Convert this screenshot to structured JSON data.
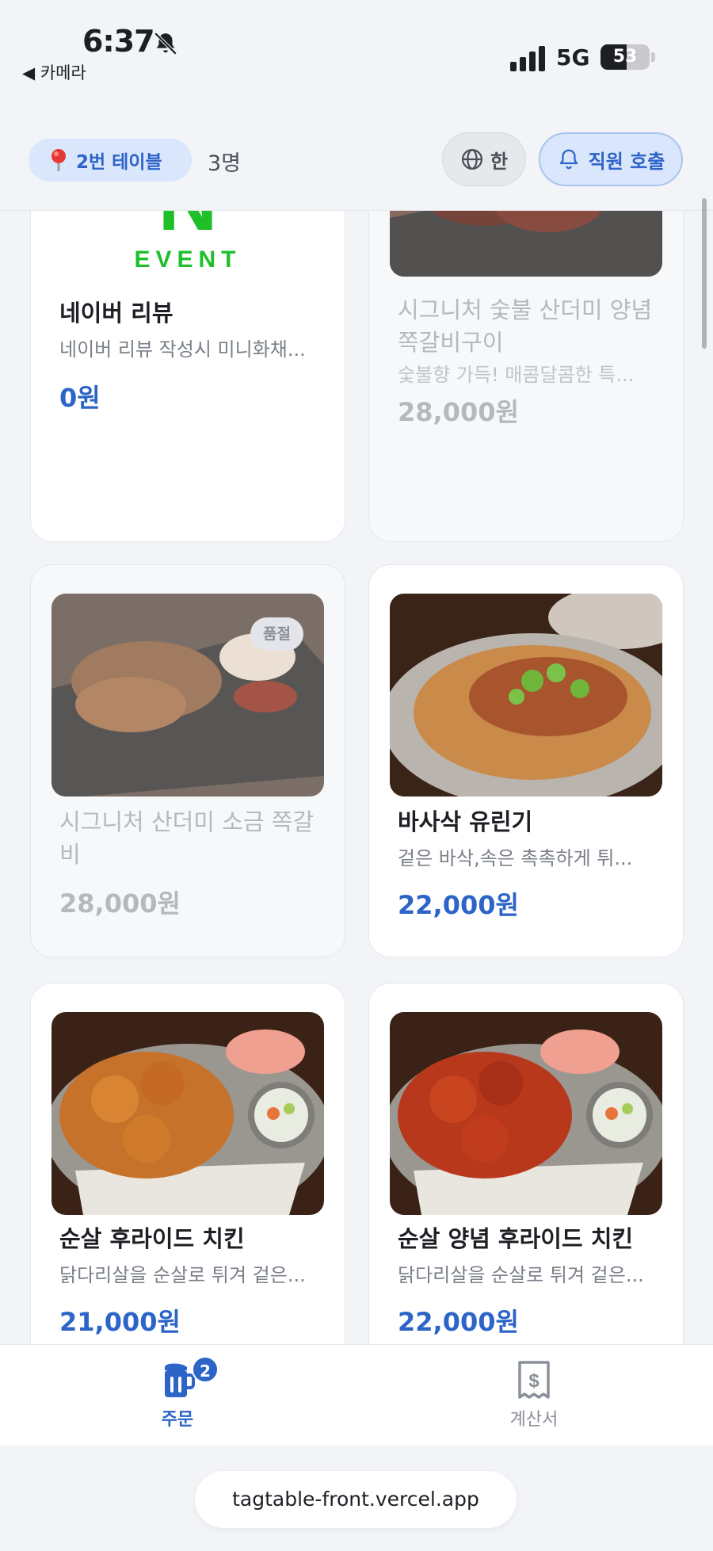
{
  "status_bar": {
    "time": "6:37",
    "back_app": "◀ 카메라",
    "network": "5G",
    "battery": "53",
    "battery_level": 0.53
  },
  "header": {
    "table_label": "2번 테이블",
    "people": "3명",
    "language": "한",
    "call_staff": "직원 호출"
  },
  "menu": [
    {
      "name": "네이버 리뷰",
      "desc": "네이버 리뷰 작성시 미니화채...",
      "price": "0원",
      "sold_out": false
    },
    {
      "name": "시그니처 숯불 산더미 양념 쪽갈비구이",
      "desc": "숯불향 가득! 매콤달콤한 특...",
      "price": "28,000원",
      "sold_out": true
    },
    {
      "name": "시그니처 산더미 소금 쪽갈비",
      "desc": "",
      "price": "28,000원",
      "sold_out": true,
      "badge": "품절"
    },
    {
      "name": "바사삭 유린기",
      "desc": "겉은 바삭,속은 촉촉하게 튀...",
      "price": "22,000원",
      "sold_out": false
    },
    {
      "name": "순살 후라이드 치킨",
      "desc": "닭다리살을 순살로 튀겨 겉은...",
      "price": "21,000원",
      "sold_out": false
    },
    {
      "name": "순살 양념 후라이드 치킨",
      "desc": "닭다리살을 순살로 튀겨 겉은...",
      "price": "22,000원",
      "sold_out": false
    }
  ],
  "event_image_text": {
    "big": "N",
    "small": "EVENT"
  },
  "tabs": {
    "order_label": "주문",
    "order_count": "2",
    "bill_label": "계산서"
  },
  "browser": {
    "url": "tagtable-front.vercel.app"
  },
  "colors": {
    "accent": "#2c64c8",
    "accent_soft": "#d9e6fb",
    "background": "#f2f4f7"
  }
}
